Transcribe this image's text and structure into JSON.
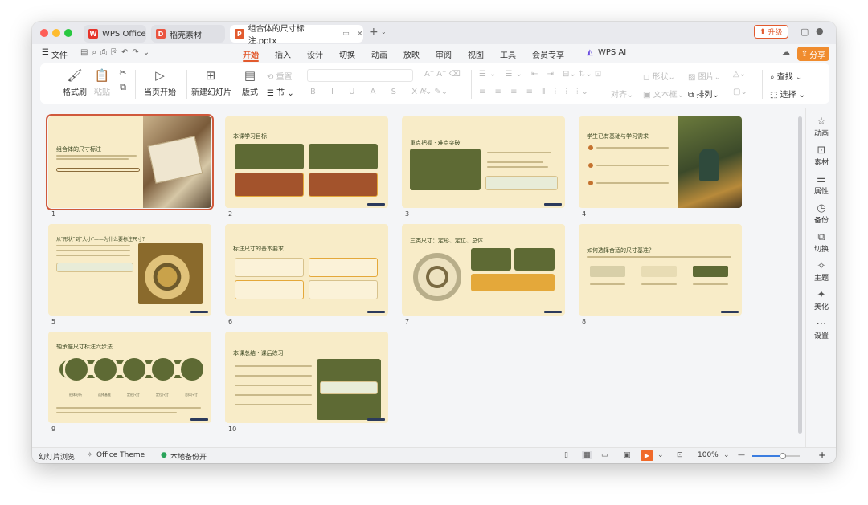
{
  "tabs": [
    {
      "label": "WPS Office",
      "icon": "wps-logo"
    },
    {
      "label": "稻壳素材",
      "icon": "docer-logo"
    },
    {
      "label": "组合体的尺寸标注.pptx",
      "icon": "presentation-file"
    }
  ],
  "upgrade_label": "升级",
  "menu": {
    "file": "文件",
    "items": [
      "开始",
      "插入",
      "设计",
      "切换",
      "动画",
      "放映",
      "审阅",
      "视图",
      "工具",
      "会员专享"
    ],
    "ai": "WPS AI",
    "share": "分享"
  },
  "ribbon": {
    "format_painter": "格式刷",
    "paste": "粘贴",
    "start_from_current": "当页开始",
    "new_slide": "新建幻灯片",
    "layout": "版式",
    "reset": "重置",
    "section": "节",
    "arrange_label": "对齐",
    "shape": "形状",
    "picture": "图片",
    "textbox": "文本框",
    "arrange": "排列",
    "find": "查找",
    "select": "选择"
  },
  "slides": [
    {
      "number": "1",
      "title": "组合体的尺寸标注"
    },
    {
      "number": "2",
      "title": "本课学习目标"
    },
    {
      "number": "3",
      "title": "重点把握 · 难点突破"
    },
    {
      "number": "4",
      "title": "学生已有基础与学习需求"
    },
    {
      "number": "5",
      "title": "从\"形状\"到\"大小\"——为什么要标注尺寸？"
    },
    {
      "number": "6",
      "title": "标注尺寸的基本要求"
    },
    {
      "number": "7",
      "title": "三类尺寸：定形、定位、总体"
    },
    {
      "number": "8",
      "title": "如何选择合适的尺寸基准？"
    },
    {
      "number": "9",
      "title": "轴承座尺寸标注六步法"
    },
    {
      "number": "10",
      "title": "本课总结 · 课后练习"
    }
  ],
  "slide9_steps": [
    "形体分析",
    "选择基准",
    "定形尺寸",
    "定位尺寸",
    "总体尺寸"
  ],
  "right_panel": [
    "动画",
    "素材",
    "属性",
    "备份",
    "切换",
    "主题",
    "美化",
    "设置"
  ],
  "status": {
    "view": "幻灯片浏览",
    "theme": "Office Theme",
    "backup": "本地备份开",
    "zoom": "100%"
  },
  "colors": {
    "accent": "#e25a2e",
    "slide_bg": "#f8ecc8",
    "slide_green": "#5e6a34",
    "slide_orange": "#e4a83a"
  }
}
